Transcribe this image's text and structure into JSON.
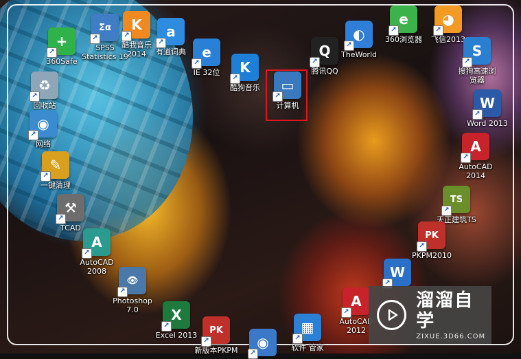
{
  "desktop": {
    "icons": [
      {
        "id": "360safe",
        "label": "360Safe",
        "glyph": "+",
        "color": "#2fb24a"
      },
      {
        "id": "spss",
        "label": "SPSS\nStatistics 19",
        "glyph": "Σα",
        "color": "#3f7ec4"
      },
      {
        "id": "kugou-music-2014",
        "label": "酷我音乐\n2014",
        "glyph": "K",
        "color": "#f08a20"
      },
      {
        "id": "youdao",
        "label": "有道词典",
        "glyph": "a",
        "color": "#2d8be0"
      },
      {
        "id": "ie",
        "label": "IE 32位",
        "glyph": "e",
        "color": "#2a80d6"
      },
      {
        "id": "kugou",
        "label": "酷狗音乐",
        "glyph": "K",
        "color": "#1e7fd8"
      },
      {
        "id": "recycle-bin",
        "label": "回收站",
        "glyph": "♻",
        "color": "#8ea6b8"
      },
      {
        "id": "computer",
        "label": "计算机",
        "glyph": "▭",
        "color": "#3a79c0"
      },
      {
        "id": "network",
        "label": "网络",
        "glyph": "◉",
        "color": "#3b8bd0"
      },
      {
        "id": "one-key-clean",
        "label": "一键清理",
        "glyph": "✎",
        "color": "#d9a020"
      },
      {
        "id": "tcad",
        "label": "TCAD",
        "glyph": "⚒",
        "color": "#6d6d6d"
      },
      {
        "id": "autocad-2008",
        "label": "AutoCAD\n2008",
        "glyph": "A",
        "color": "#2b9a8f"
      },
      {
        "id": "photoshop",
        "label": "Photoshop\n7.0",
        "glyph": "👁",
        "color": "#4a78a8"
      },
      {
        "id": "excel",
        "label": "Excel 2013",
        "glyph": "X",
        "color": "#1e7a3c"
      },
      {
        "id": "pkpm-new",
        "label": "新版本PKPM",
        "glyph": "PK",
        "color": "#c0302a"
      },
      {
        "id": "globe",
        "label": "",
        "glyph": "◉",
        "color": "#3b78c8"
      },
      {
        "id": "tile-app",
        "label": "软件 管家",
        "glyph": "▦",
        "color": "#2b7fd4"
      },
      {
        "id": "qq",
        "label": "腾讯QQ",
        "glyph": "Q",
        "color": "#222222"
      },
      {
        "id": "theworld",
        "label": "TheWorld",
        "glyph": "◐",
        "color": "#2f7fd8"
      },
      {
        "id": "360browser",
        "label": "360浏览器",
        "glyph": "e",
        "color": "#3bb24a"
      },
      {
        "id": "fetion",
        "label": "飞信2013",
        "glyph": "◕",
        "color": "#f29a24"
      },
      {
        "id": "sogou",
        "label": "搜狗高速浏\n览器",
        "glyph": "S",
        "color": "#2a7fd0"
      },
      {
        "id": "word",
        "label": "Word 2013",
        "glyph": "W",
        "color": "#2a5aa8"
      },
      {
        "id": "autocad-2014",
        "label": "AutoCAD\n2014",
        "glyph": "A",
        "color": "#c8222a"
      },
      {
        "id": "tianzheng",
        "label": "天正建筑TS",
        "glyph": "TS",
        "color": "#6a8f2a"
      },
      {
        "id": "pkpm2010",
        "label": "PKPM2010",
        "glyph": "PK",
        "color": "#c0302a"
      },
      {
        "id": "wps",
        "label": "",
        "glyph": "W",
        "color": "#2a6fc8"
      },
      {
        "id": "autocad-2012",
        "label": "AutoCAD\n2012",
        "glyph": "A",
        "color": "#c8222a"
      }
    ],
    "selected": "计算机"
  },
  "watermark": {
    "title": "溜溜自学",
    "url": "ZIXUE.3D66.COM"
  }
}
